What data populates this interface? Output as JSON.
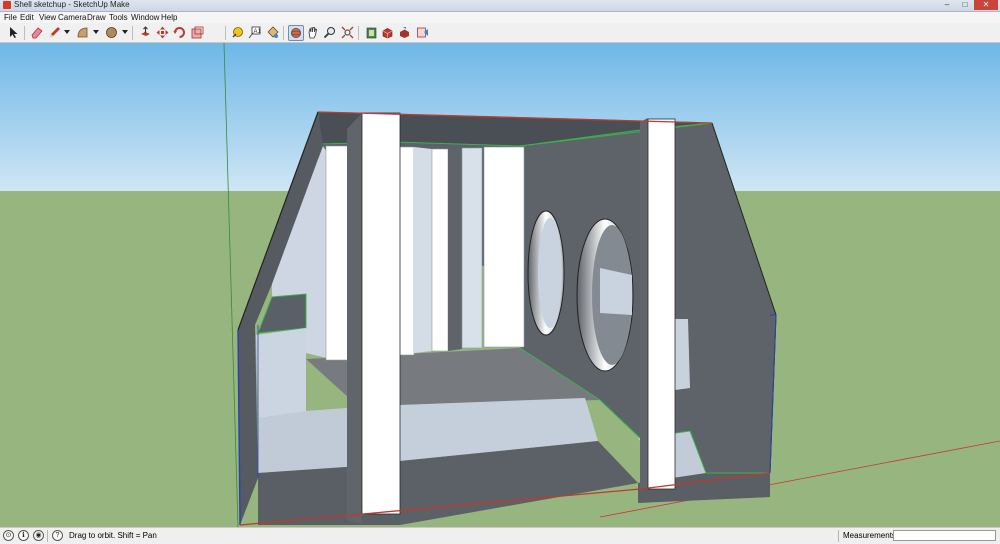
{
  "window": {
    "title": "Shell sketchup - SketchUp Make",
    "minimize": "–",
    "maximize": "□",
    "close": "✕"
  },
  "menu": [
    "File",
    "Edit",
    "View",
    "Camera",
    "Draw",
    "Tools",
    "Window",
    "Help"
  ],
  "toolbar": {
    "icons": [
      "select-icon",
      "eraser-icon",
      "pencil-icon",
      "arc-icon",
      "shape-icon",
      "push-pull-icon",
      "move-icon",
      "rotate-icon",
      "scale-icon",
      "tape-measure-icon",
      "text-icon",
      "paint-bucket-icon",
      "orbit-icon",
      "pan-icon",
      "zoom-icon",
      "zoom-extents-icon",
      "warehouse-icon",
      "components-icon",
      "share-model-icon",
      "extension-icon"
    ]
  },
  "status": {
    "hint": "Drag to orbit.  Shift = Pan",
    "measurements_label": "Measurements",
    "measurements_value": ""
  },
  "colors": {
    "sky": "#7cbde8",
    "ground": "#97b67f",
    "model_dark": "#5a6068",
    "model_light": "#c8d3df",
    "model_white": "#ffffff"
  }
}
